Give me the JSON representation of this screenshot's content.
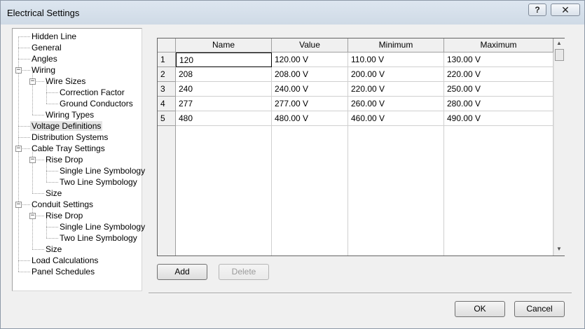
{
  "window": {
    "title": "Electrical Settings",
    "help_label": "?",
    "close_label": "✕"
  },
  "tree": {
    "items": [
      {
        "label": "Hidden Line"
      },
      {
        "label": "General"
      },
      {
        "label": "Angles"
      },
      {
        "label": "Wiring",
        "expander": "−"
      },
      {
        "label": "Wire Sizes",
        "expander": "−"
      },
      {
        "label": "Correction Factor"
      },
      {
        "label": "Ground Conductors"
      },
      {
        "label": "Wiring Types"
      },
      {
        "label": "Voltage Definitions",
        "selected": true
      },
      {
        "label": "Distribution Systems"
      },
      {
        "label": "Cable Tray Settings",
        "expander": "−"
      },
      {
        "label": "Rise Drop",
        "expander": "−"
      },
      {
        "label": "Single Line Symbology"
      },
      {
        "label": "Two Line Symbology"
      },
      {
        "label": "Size"
      },
      {
        "label": "Conduit Settings",
        "expander": "−"
      },
      {
        "label": "Rise Drop",
        "expander": "−"
      },
      {
        "label": "Single Line Symbology"
      },
      {
        "label": "Two Line Symbology"
      },
      {
        "label": "Size"
      },
      {
        "label": "Load Calculations"
      },
      {
        "label": "Panel Schedules"
      }
    ]
  },
  "grid": {
    "columns": [
      "Name",
      "Value",
      "Minimum",
      "Maximum"
    ],
    "rows": [
      {
        "num": "1",
        "cells": [
          "120",
          "120.00 V",
          "110.00 V",
          "130.00 V"
        ]
      },
      {
        "num": "2",
        "cells": [
          "208",
          "208.00 V",
          "200.00 V",
          "220.00 V"
        ]
      },
      {
        "num": "3",
        "cells": [
          "240",
          "240.00 V",
          "220.00 V",
          "250.00 V"
        ]
      },
      {
        "num": "4",
        "cells": [
          "277",
          "277.00 V",
          "260.00 V",
          "280.00 V"
        ]
      },
      {
        "num": "5",
        "cells": [
          "480",
          "480.00 V",
          "460.00 V",
          "490.00 V"
        ]
      }
    ],
    "scroll_up": "▲",
    "scroll_down": "▼"
  },
  "buttons": {
    "add": "Add",
    "delete": "Delete",
    "ok": "OK",
    "cancel": "Cancel"
  }
}
